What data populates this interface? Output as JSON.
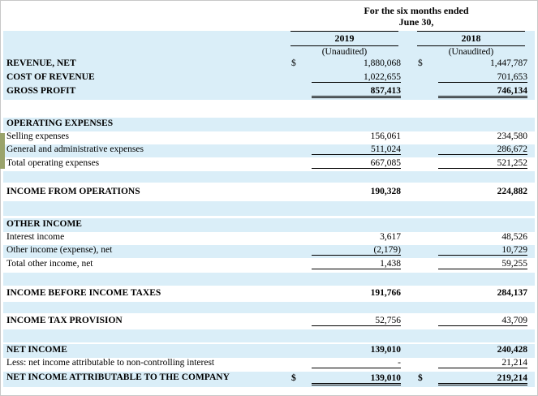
{
  "header": {
    "period_line1": "For the six months ended",
    "period_line2": "June 30,",
    "year_2019": "2019",
    "year_2018": "2018",
    "unaudited_2019": "(Unaudited)",
    "unaudited_2018": "(Unaudited)"
  },
  "currency_symbol": "$",
  "rows": {
    "revenue": {
      "label": "REVENUE, NET",
      "v2019": "1,880,068",
      "v2018": "1,447,787"
    },
    "cost": {
      "label": "COST OF REVENUE",
      "v2019": "1,022,655",
      "v2018": "701,653"
    },
    "gross": {
      "label": "GROSS PROFIT",
      "v2019": "857,413",
      "v2018": "746,134"
    },
    "opex_head": {
      "label": "OPERATING EXPENSES"
    },
    "selling": {
      "label": "Selling expenses",
      "v2019": "156,061",
      "v2018": "234,580"
    },
    "ga": {
      "label": "General and administrative expenses",
      "v2019": "511,024",
      "v2018": "286,672"
    },
    "total_opex": {
      "label": "Total operating expenses",
      "v2019": "667,085",
      "v2018": "521,252"
    },
    "income_ops": {
      "label": "INCOME FROM OPERATIONS",
      "v2019": "190,328",
      "v2018": "224,882"
    },
    "other_head": {
      "label": "OTHER INCOME"
    },
    "interest": {
      "label": "Interest income",
      "v2019": "3,617",
      "v2018": "48,526"
    },
    "other_net": {
      "label": "Other income (expense), net",
      "v2019": "(2,179)",
      "v2018": "10,729"
    },
    "total_other": {
      "label": "Total other income, net",
      "v2019": "1,438",
      "v2018": "59,255"
    },
    "before_tax": {
      "label": "INCOME BEFORE INCOME TAXES",
      "v2019": "191,766",
      "v2018": "284,137"
    },
    "tax": {
      "label": "INCOME TAX PROVISION",
      "v2019": "52,756",
      "v2018": "43,709"
    },
    "net_income": {
      "label": "NET INCOME",
      "v2019": "139,010",
      "v2018": "240,428"
    },
    "nci": {
      "label": "Less: net income attributable to non-controlling interest",
      "v2019": "-",
      "v2018": "21,214"
    },
    "net_company": {
      "label": "NET INCOME ATTRIBUTABLE TO THE COMPANY",
      "v2019": "139,010",
      "v2018": "219,214"
    }
  }
}
